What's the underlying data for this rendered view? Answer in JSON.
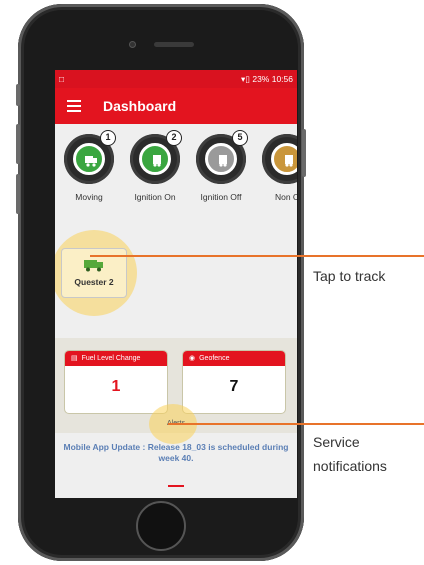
{
  "status_bar": {
    "left_icon": "notification-icon",
    "right_text": "23% 10:56"
  },
  "app_bar": {
    "title": "Dashboard",
    "menu_icon": "hamburger-icon"
  },
  "vehicle_statuses": [
    {
      "label": "Moving",
      "count": "1",
      "color": "#3aa640"
    },
    {
      "label": "Ignition On",
      "count": "2",
      "color": "#3aa640"
    },
    {
      "label": "Ignition Off",
      "count": "5",
      "color": "#9a9a9a"
    },
    {
      "label": "Non C",
      "count": "",
      "color": "#c9963b"
    }
  ],
  "vehicles": [
    {
      "name": "Quester 2",
      "icon": "truck-icon"
    }
  ],
  "alerts": {
    "label": "Alerts",
    "cards": [
      {
        "title": "Fuel Level Change",
        "value": "1",
        "icon": "fuel-icon",
        "value_color": "#e3141f"
      },
      {
        "title": "Geofence",
        "value": "7",
        "icon": "location-pin-icon",
        "value_color": "#111111"
      }
    ]
  },
  "update_message": "Mobile App Update : Release 18_03 is scheduled during week 40.",
  "callouts": {
    "track": "Tap to track",
    "service_line1": "Service",
    "service_line2": "notifications"
  },
  "colors": {
    "brand_red": "#e3141f",
    "callout_orange": "#e8732a",
    "halo_yellow": "#f9d65a"
  }
}
